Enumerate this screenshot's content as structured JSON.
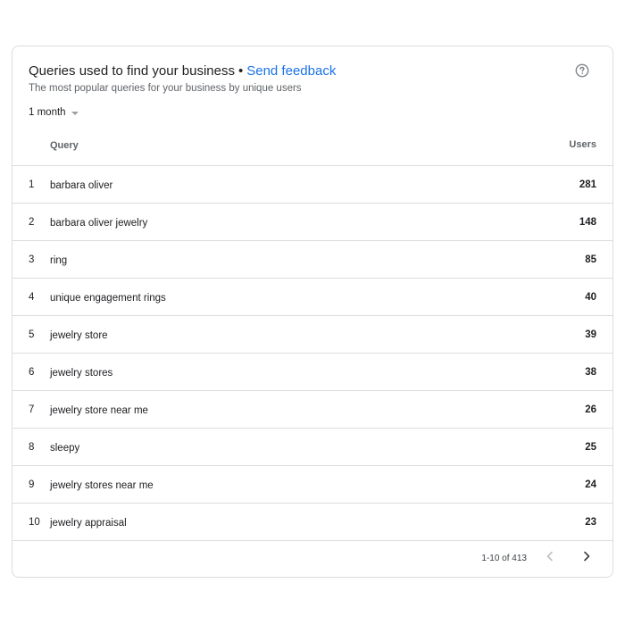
{
  "header": {
    "title": "Queries used to find your business",
    "separator": "•",
    "feedback_link": "Send feedback",
    "subtitle": "The most popular queries for your business by unique users",
    "help_icon": "help-circle-icon"
  },
  "filter": {
    "period": "1 month"
  },
  "table": {
    "columns": {
      "query": "Query",
      "users": "Users"
    },
    "rows": [
      {
        "rank": "1",
        "query": "barbara oliver",
        "users": "281"
      },
      {
        "rank": "2",
        "query": "barbara oliver jewelry",
        "users": "148"
      },
      {
        "rank": "3",
        "query": "ring",
        "users": "85"
      },
      {
        "rank": "4",
        "query": "unique engagement rings",
        "users": "40"
      },
      {
        "rank": "5",
        "query": "jewelry store",
        "users": "39"
      },
      {
        "rank": "6",
        "query": "jewelry stores",
        "users": "38"
      },
      {
        "rank": "7",
        "query": "jewelry store near me",
        "users": "26"
      },
      {
        "rank": "8",
        "query": "sleepy",
        "users": "25"
      },
      {
        "rank": "9",
        "query": "jewelry stores near me",
        "users": "24"
      },
      {
        "rank": "10",
        "query": "jewelry appraisal",
        "users": "23"
      }
    ]
  },
  "pagination": {
    "range_text": "1-10 of 413",
    "prev_icon": "chevron-left-icon",
    "next_icon": "chevron-right-icon"
  },
  "colors": {
    "link": "#1a73e8",
    "text": "#202124",
    "muted": "#5f6368",
    "border": "#dadce0"
  }
}
